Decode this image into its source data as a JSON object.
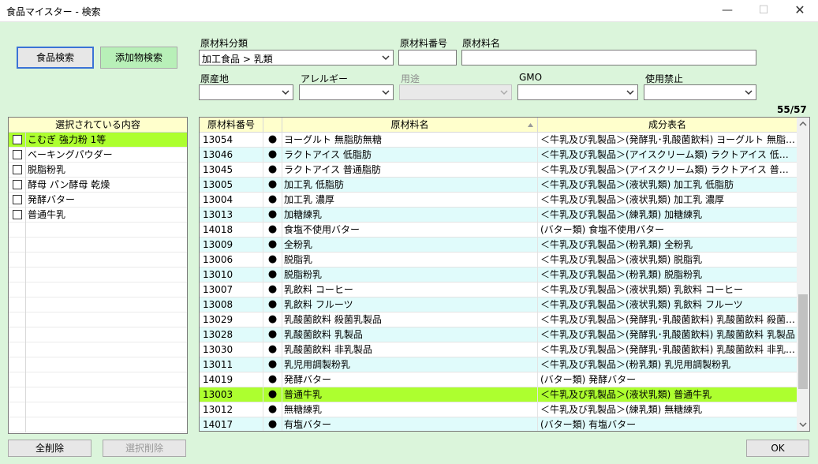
{
  "window": {
    "title": "食品マイスター - 検索",
    "min": "—",
    "max": "☐",
    "close": "✕"
  },
  "buttons": {
    "food_search": "食品検索",
    "additive_search": "添加物検索",
    "clear_all": "全削除",
    "delete_selected": "選択削除",
    "ok": "OK"
  },
  "filters": {
    "category_label": "原材料分類",
    "category_value": "加工食品 > 乳類",
    "number_label": "原材料番号",
    "number_value": "",
    "name_label": "原材料名",
    "name_value": "",
    "origin_label": "原産地",
    "origin_value": "",
    "allergy_label": "アレルギー",
    "allergy_value": "",
    "usage_label": "用途",
    "usage_value": "",
    "gmo_label": "GMO",
    "gmo_value": "",
    "banned_label": "使用禁止",
    "banned_value": ""
  },
  "result_count": "55/57",
  "selected": {
    "header": "選択されている内容",
    "items": [
      "こむぎ 強力粉 1等",
      "ベーキングパウダー",
      "脱脂粉乳",
      "酵母 パン酵母 乾燥",
      "発酵バター",
      "普通牛乳"
    ]
  },
  "grid": {
    "headers": [
      "原材料番号",
      "原材料名",
      "成分表名"
    ],
    "rows": [
      {
        "no": "13054",
        "mark": "●",
        "name": "ヨーグルト 無脂肪無糖",
        "comp": "＜牛乳及び乳製品＞(発酵乳･乳酸菌飲料) ヨーグルト 無脂肪無糖"
      },
      {
        "no": "13046",
        "mark": "●",
        "name": "ラクトアイス 低脂肪",
        "comp": "＜牛乳及び乳製品＞(アイスクリーム類) ラクトアイス 低脂肪"
      },
      {
        "no": "13045",
        "mark": "●",
        "name": "ラクトアイス 普通脂肪",
        "comp": "＜牛乳及び乳製品＞(アイスクリーム類) ラクトアイス 普通脂肪"
      },
      {
        "no": "13005",
        "mark": "●",
        "name": "加工乳 低脂肪",
        "comp": "＜牛乳及び乳製品＞(液状乳類) 加工乳 低脂肪"
      },
      {
        "no": "13004",
        "mark": "●",
        "name": "加工乳 濃厚",
        "comp": "＜牛乳及び乳製品＞(液状乳類) 加工乳 濃厚"
      },
      {
        "no": "13013",
        "mark": "●",
        "name": "加糖練乳",
        "comp": "＜牛乳及び乳製品＞(練乳類) 加糖練乳"
      },
      {
        "no": "14018",
        "mark": "●",
        "name": "食塩不使用バター",
        "comp": "(バター類) 食塩不使用バター"
      },
      {
        "no": "13009",
        "mark": "●",
        "name": "全粉乳",
        "comp": "＜牛乳及び乳製品＞(粉乳類) 全粉乳"
      },
      {
        "no": "13006",
        "mark": "●",
        "name": "脱脂乳",
        "comp": "＜牛乳及び乳製品＞(液状乳類) 脱脂乳"
      },
      {
        "no": "13010",
        "mark": "●",
        "name": "脱脂粉乳",
        "comp": "＜牛乳及び乳製品＞(粉乳類) 脱脂粉乳"
      },
      {
        "no": "13007",
        "mark": "●",
        "name": "乳飲料 コーヒー",
        "comp": "＜牛乳及び乳製品＞(液状乳類) 乳飲料 コーヒー"
      },
      {
        "no": "13008",
        "mark": "●",
        "name": "乳飲料 フルーツ",
        "comp": "＜牛乳及び乳製品＞(液状乳類) 乳飲料 フルーツ"
      },
      {
        "no": "13029",
        "mark": "●",
        "name": "乳酸菌飲料 殺菌乳製品",
        "comp": "＜牛乳及び乳製品＞(発酵乳･乳酸菌飲料) 乳酸菌飲料 殺菌乳製品"
      },
      {
        "no": "13028",
        "mark": "●",
        "name": "乳酸菌飲料 乳製品",
        "comp": "＜牛乳及び乳製品＞(発酵乳･乳酸菌飲料) 乳酸菌飲料 乳製品"
      },
      {
        "no": "13030",
        "mark": "●",
        "name": "乳酸菌飲料 非乳製品",
        "comp": "＜牛乳及び乳製品＞(発酵乳･乳酸菌飲料) 乳酸菌飲料 非乳製品"
      },
      {
        "no": "13011",
        "mark": "●",
        "name": "乳児用調製粉乳",
        "comp": "＜牛乳及び乳製品＞(粉乳類) 乳児用調製粉乳"
      },
      {
        "no": "14019",
        "mark": "●",
        "name": "発酵バター",
        "comp": "(バター類) 発酵バター"
      },
      {
        "no": "13003",
        "mark": "●",
        "name": "普通牛乳",
        "comp": "＜牛乳及び乳製品＞(液状乳類) 普通牛乳"
      },
      {
        "no": "13012",
        "mark": "●",
        "name": "無糖練乳",
        "comp": "＜牛乳及び乳製品＞(練乳類) 無糖練乳"
      },
      {
        "no": "14017",
        "mark": "●",
        "name": "有塩バター",
        "comp": "(バター類) 有塩バター"
      }
    ],
    "highlighted_no": "13003",
    "scroll_position": 0.85
  }
}
